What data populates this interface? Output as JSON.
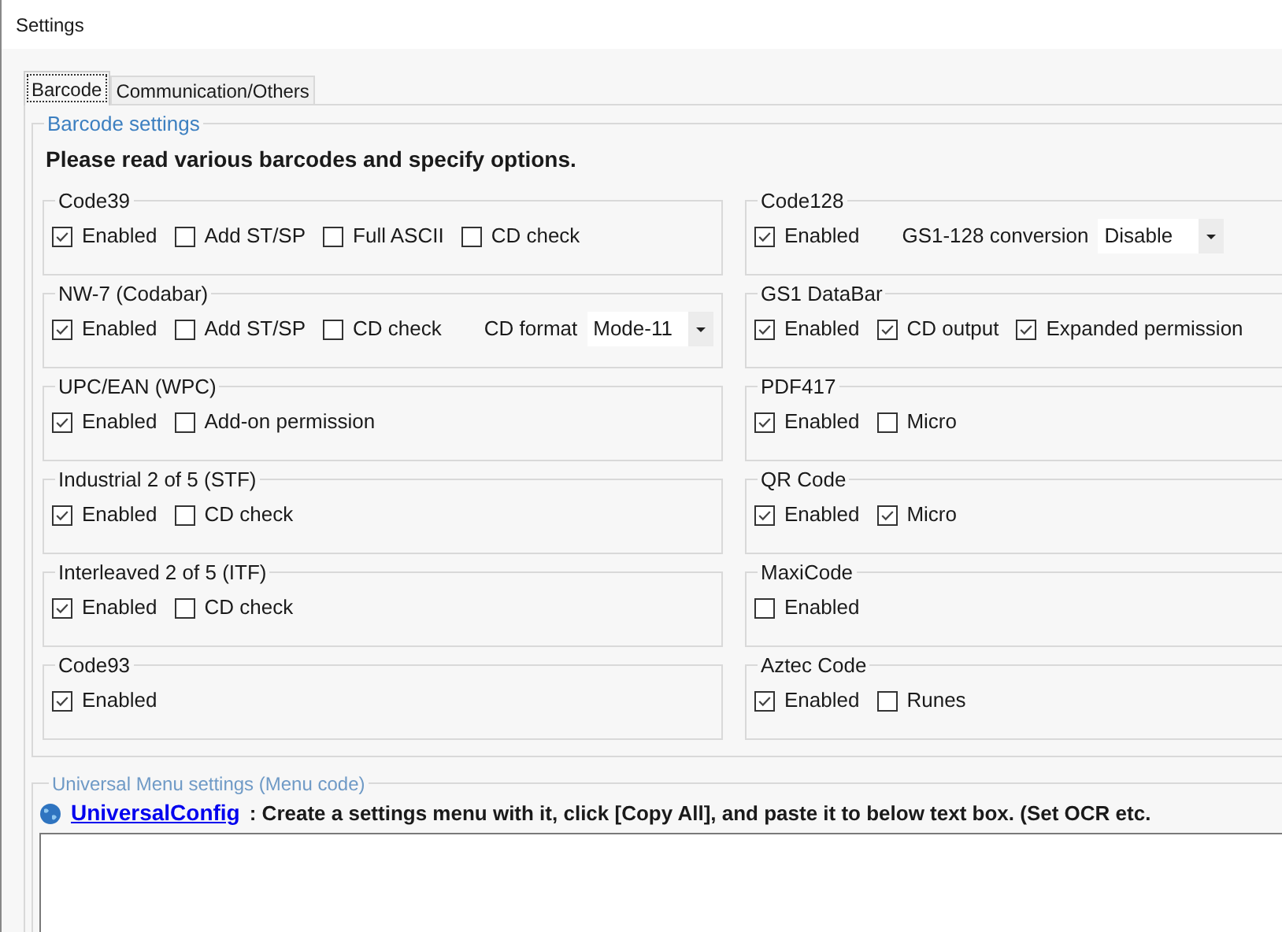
{
  "window": {
    "title": "Settings"
  },
  "tabs": [
    {
      "label": "Barcode",
      "selected": true
    },
    {
      "label": "Communication/Others",
      "selected": false
    }
  ],
  "barcode_settings": {
    "legend": "Barcode settings",
    "instruction": "Please read various barcodes and specify options.",
    "columns": [
      [
        {
          "title": "Code39",
          "items": [
            {
              "kind": "checkbox",
              "label": "Enabled",
              "checked": true
            },
            {
              "kind": "checkbox",
              "label": "Add ST/SP",
              "checked": false
            },
            {
              "kind": "checkbox",
              "label": "Full ASCII",
              "checked": false
            },
            {
              "kind": "checkbox",
              "label": "CD check",
              "checked": false
            }
          ]
        },
        {
          "title": "NW-7 (Codabar)",
          "items": [
            {
              "kind": "checkbox",
              "label": "Enabled",
              "checked": true
            },
            {
              "kind": "checkbox",
              "label": "Add ST/SP",
              "checked": false
            },
            {
              "kind": "checkbox",
              "label": "CD check",
              "checked": false
            },
            {
              "kind": "select",
              "label": "CD format",
              "value": "Mode-11"
            }
          ]
        },
        {
          "title": "UPC/EAN (WPC)",
          "items": [
            {
              "kind": "checkbox",
              "label": "Enabled",
              "checked": true
            },
            {
              "kind": "checkbox",
              "label": "Add-on permission",
              "checked": false
            }
          ]
        },
        {
          "title": "Industrial 2 of 5 (STF)",
          "items": [
            {
              "kind": "checkbox",
              "label": "Enabled",
              "checked": true
            },
            {
              "kind": "checkbox",
              "label": "CD check",
              "checked": false
            }
          ]
        },
        {
          "title": "Interleaved 2 of 5 (ITF)",
          "items": [
            {
              "kind": "checkbox",
              "label": "Enabled",
              "checked": true
            },
            {
              "kind": "checkbox",
              "label": "CD check",
              "checked": false
            }
          ]
        },
        {
          "title": "Code93",
          "items": [
            {
              "kind": "checkbox",
              "label": "Enabled",
              "checked": true
            }
          ]
        }
      ],
      [
        {
          "title": "Code128",
          "items": [
            {
              "kind": "checkbox",
              "label": "Enabled",
              "checked": true
            },
            {
              "kind": "select",
              "label": "GS1-128 conversion",
              "value": "Disable"
            }
          ]
        },
        {
          "title": "GS1 DataBar",
          "items": [
            {
              "kind": "checkbox",
              "label": "Enabled",
              "checked": true
            },
            {
              "kind": "checkbox",
              "label": "CD output",
              "checked": true
            },
            {
              "kind": "checkbox",
              "label": "Expanded permission",
              "checked": true
            }
          ]
        },
        {
          "title": "PDF417",
          "items": [
            {
              "kind": "checkbox",
              "label": "Enabled",
              "checked": true
            },
            {
              "kind": "checkbox",
              "label": "Micro",
              "checked": false
            }
          ]
        },
        {
          "title": "QR Code",
          "items": [
            {
              "kind": "checkbox",
              "label": "Enabled",
              "checked": true
            },
            {
              "kind": "checkbox",
              "label": "Micro",
              "checked": true
            }
          ]
        },
        {
          "title": "MaxiCode",
          "items": [
            {
              "kind": "checkbox",
              "label": "Enabled",
              "checked": false
            }
          ]
        },
        {
          "title": "Aztec Code",
          "items": [
            {
              "kind": "checkbox",
              "label": "Enabled",
              "checked": true
            },
            {
              "kind": "checkbox",
              "label": "Runes",
              "checked": false
            }
          ]
        }
      ]
    ]
  },
  "universal_menu": {
    "legend": "Universal Menu settings (Menu code)",
    "link": "UniversalConfig",
    "description": ": Create a settings menu with it, click [Copy All], and paste it to below text box. (Set OCR etc."
  }
}
